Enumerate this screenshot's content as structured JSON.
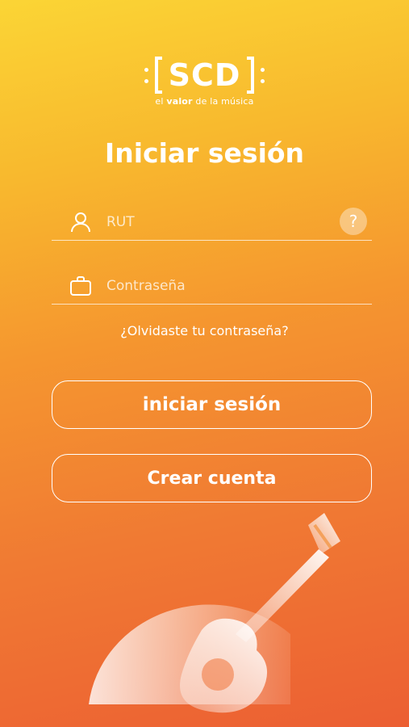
{
  "logo": {
    "brand": "SCD",
    "tagline_pre": "el ",
    "tagline_bold": "valor",
    "tagline_post": " de la música"
  },
  "title": "Iniciar sesión",
  "form": {
    "rut_placeholder": "RUT",
    "rut_value": "",
    "help_label": "?",
    "password_placeholder": "Contraseña",
    "password_value": ""
  },
  "forgot_link": "¿Olvidaste tu contraseña?",
  "buttons": {
    "login": "iniciar sesión",
    "create": "Crear cuenta"
  },
  "colors": {
    "gradient_top": "#fbd535",
    "gradient_bottom": "#ec5f33",
    "foreground": "#ffffff"
  }
}
